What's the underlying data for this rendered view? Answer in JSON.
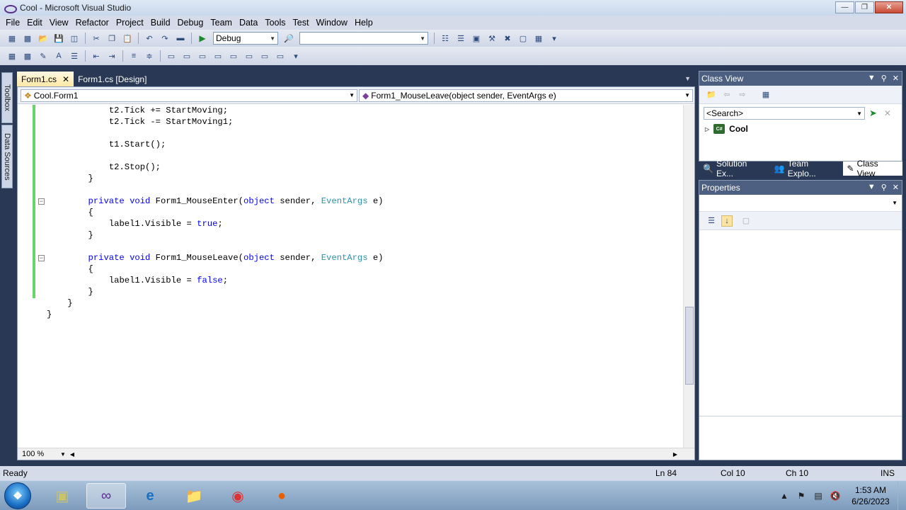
{
  "window": {
    "title": "Cool - Microsoft Visual Studio"
  },
  "menu": [
    "File",
    "Edit",
    "View",
    "Refactor",
    "Project",
    "Build",
    "Debug",
    "Team",
    "Data",
    "Tools",
    "Test",
    "Window",
    "Help"
  ],
  "toolbar": {
    "config": "Debug",
    "platform": ""
  },
  "side_tabs": [
    "Toolbox",
    "Data Sources"
  ],
  "doc_tabs": [
    {
      "label": "Form1.cs",
      "active": true
    },
    {
      "label": "Form1.cs [Design]",
      "active": false
    }
  ],
  "navbar": {
    "type": "Cool.Form1",
    "member": "Form1_MouseLeave(object sender, EventArgs e)"
  },
  "code": [
    {
      "indent": 12,
      "parts": [
        [
          "t2.Tick += StartMoving;",
          ""
        ]
      ]
    },
    {
      "indent": 12,
      "parts": [
        [
          "t2.Tick -= StartMoving1;",
          ""
        ]
      ]
    },
    {
      "indent": 0,
      "parts": []
    },
    {
      "indent": 12,
      "parts": [
        [
          "t1.Start();",
          ""
        ]
      ]
    },
    {
      "indent": 0,
      "parts": []
    },
    {
      "indent": 12,
      "parts": [
        [
          "t2.Stop();",
          ""
        ]
      ]
    },
    {
      "indent": 8,
      "parts": [
        [
          "}",
          ""
        ]
      ]
    },
    {
      "indent": 0,
      "parts": []
    },
    {
      "indent": 8,
      "parts": [
        [
          "private",
          "kw"
        ],
        [
          " ",
          ""
        ],
        [
          "void",
          "kw"
        ],
        [
          " Form1_MouseEnter(",
          ""
        ],
        [
          "object",
          "kw"
        ],
        [
          " sender, ",
          ""
        ],
        [
          "EventArgs",
          "ty"
        ],
        [
          " e)",
          ""
        ]
      ]
    },
    {
      "indent": 8,
      "parts": [
        [
          "{",
          ""
        ]
      ]
    },
    {
      "indent": 12,
      "parts": [
        [
          "label1.Visible = ",
          ""
        ],
        [
          "true",
          "kw"
        ],
        [
          ";",
          ""
        ]
      ]
    },
    {
      "indent": 8,
      "parts": [
        [
          "}",
          ""
        ]
      ]
    },
    {
      "indent": 0,
      "parts": []
    },
    {
      "indent": 8,
      "parts": [
        [
          "private",
          "kw"
        ],
        [
          " ",
          ""
        ],
        [
          "void",
          "kw"
        ],
        [
          " Form1_MouseLeave(",
          ""
        ],
        [
          "object",
          "kw"
        ],
        [
          " sender, ",
          ""
        ],
        [
          "EventArgs",
          "ty"
        ],
        [
          " e)",
          ""
        ]
      ]
    },
    {
      "indent": 8,
      "parts": [
        [
          "{",
          ""
        ]
      ]
    },
    {
      "indent": 12,
      "parts": [
        [
          "label1.Visible = ",
          ""
        ],
        [
          "false",
          "kw"
        ],
        [
          ";",
          ""
        ]
      ]
    },
    {
      "indent": 8,
      "parts": [
        [
          "}",
          ""
        ]
      ]
    },
    {
      "indent": 4,
      "parts": [
        [
          "}",
          ""
        ]
      ]
    },
    {
      "indent": 0,
      "parts": [
        [
          "}",
          ""
        ]
      ]
    }
  ],
  "editor": {
    "zoom": "100 %"
  },
  "class_view": {
    "title": "Class View",
    "search_placeholder": "<Search>",
    "tree_root": "Cool"
  },
  "panel_tabs": [
    "Solution Ex...",
    "Team Explo...",
    "Class View"
  ],
  "properties": {
    "title": "Properties"
  },
  "status": {
    "ready": "Ready",
    "ln": "Ln 84",
    "col": "Col 10",
    "ch": "Ch 10",
    "ins": "INS"
  },
  "taskbar": {
    "time": "1:53 AM",
    "date": "6/26/2023"
  },
  "colors": {
    "keyword": "#0000ff",
    "type": "#2b91af",
    "change_bar": "#6bd36b",
    "panel_header": "#4d6082"
  }
}
